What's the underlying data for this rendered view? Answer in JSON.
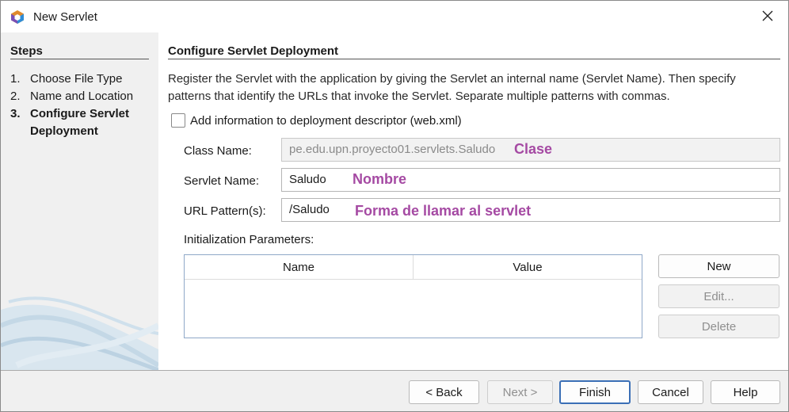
{
  "window": {
    "title": "New Servlet",
    "colors": {
      "accent": "#3b6fb6",
      "annotation": "#a54aa3",
      "panel_bg": "#f0f0f0"
    }
  },
  "steps": {
    "heading": "Steps",
    "items": [
      {
        "num": "1.",
        "label": "Choose File Type",
        "current": false
      },
      {
        "num": "2.",
        "label": "Name and Location",
        "current": false
      },
      {
        "num": "3.",
        "label": "Configure Servlet Deployment",
        "current": true
      }
    ]
  },
  "main": {
    "heading": "Configure Servlet Deployment",
    "description": "Register the Servlet with the application by giving the Servlet an internal name (Servlet Name). Then specify patterns that identify the URLs that invoke the Servlet. Separate multiple patterns with commas.",
    "checkbox_label": "Add information to deployment descriptor (web.xml)",
    "checkbox_checked": false,
    "fields": {
      "class_name": {
        "label": "Class Name:",
        "value": "pe.edu.upn.proyecto01.servlets.Saludo",
        "annotation": "Clase"
      },
      "servlet_name": {
        "label": "Servlet Name:",
        "value": "Saludo",
        "annotation": "Nombre"
      },
      "url_pattern": {
        "label": "URL Pattern(s):",
        "value": "/Saludo",
        "annotation": "Forma de llamar al servlet"
      }
    },
    "params": {
      "label": "Initialization Parameters:",
      "columns": [
        "Name",
        "Value"
      ],
      "rows": []
    },
    "buttons": {
      "new": "New",
      "edit": "Edit...",
      "delete": "Delete"
    }
  },
  "footer": {
    "back": "< Back",
    "next": "Next >",
    "finish": "Finish",
    "cancel": "Cancel",
    "help": "Help"
  }
}
